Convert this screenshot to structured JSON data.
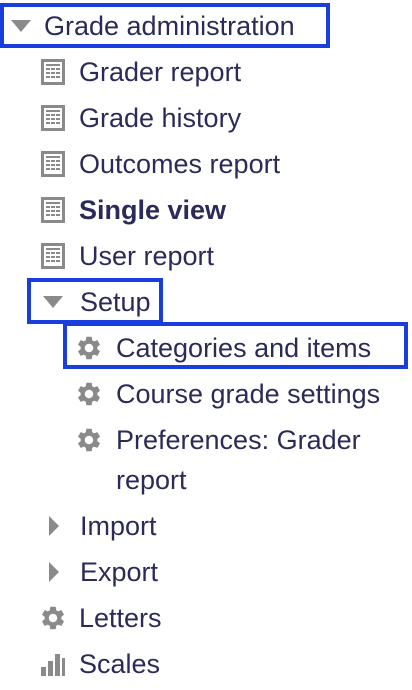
{
  "nav": {
    "grade_administration": "Grade administration",
    "grader_report": "Grader report",
    "grade_history": "Grade history",
    "outcomes_report": "Outcomes report",
    "single_view": "Single view",
    "user_report": "User report",
    "setup": "Setup",
    "categories_and_items": "Categories and items",
    "course_grade_settings": "Course grade settings",
    "preferences_grader_report_line1": "Preferences: Grader",
    "preferences_grader_report_line2": "report",
    "import": "Import",
    "export": "Export",
    "letters": "Letters",
    "scales": "Scales"
  },
  "colors": {
    "text": "#2b2a59",
    "icon": "#8a8a8a",
    "highlight": "#1a3de0"
  },
  "icons": {
    "expanded": "triangle-down-icon",
    "collapsed": "triangle-right-icon",
    "report": "report-icon",
    "settings": "gear-icon",
    "scales": "bar-chart-icon"
  }
}
